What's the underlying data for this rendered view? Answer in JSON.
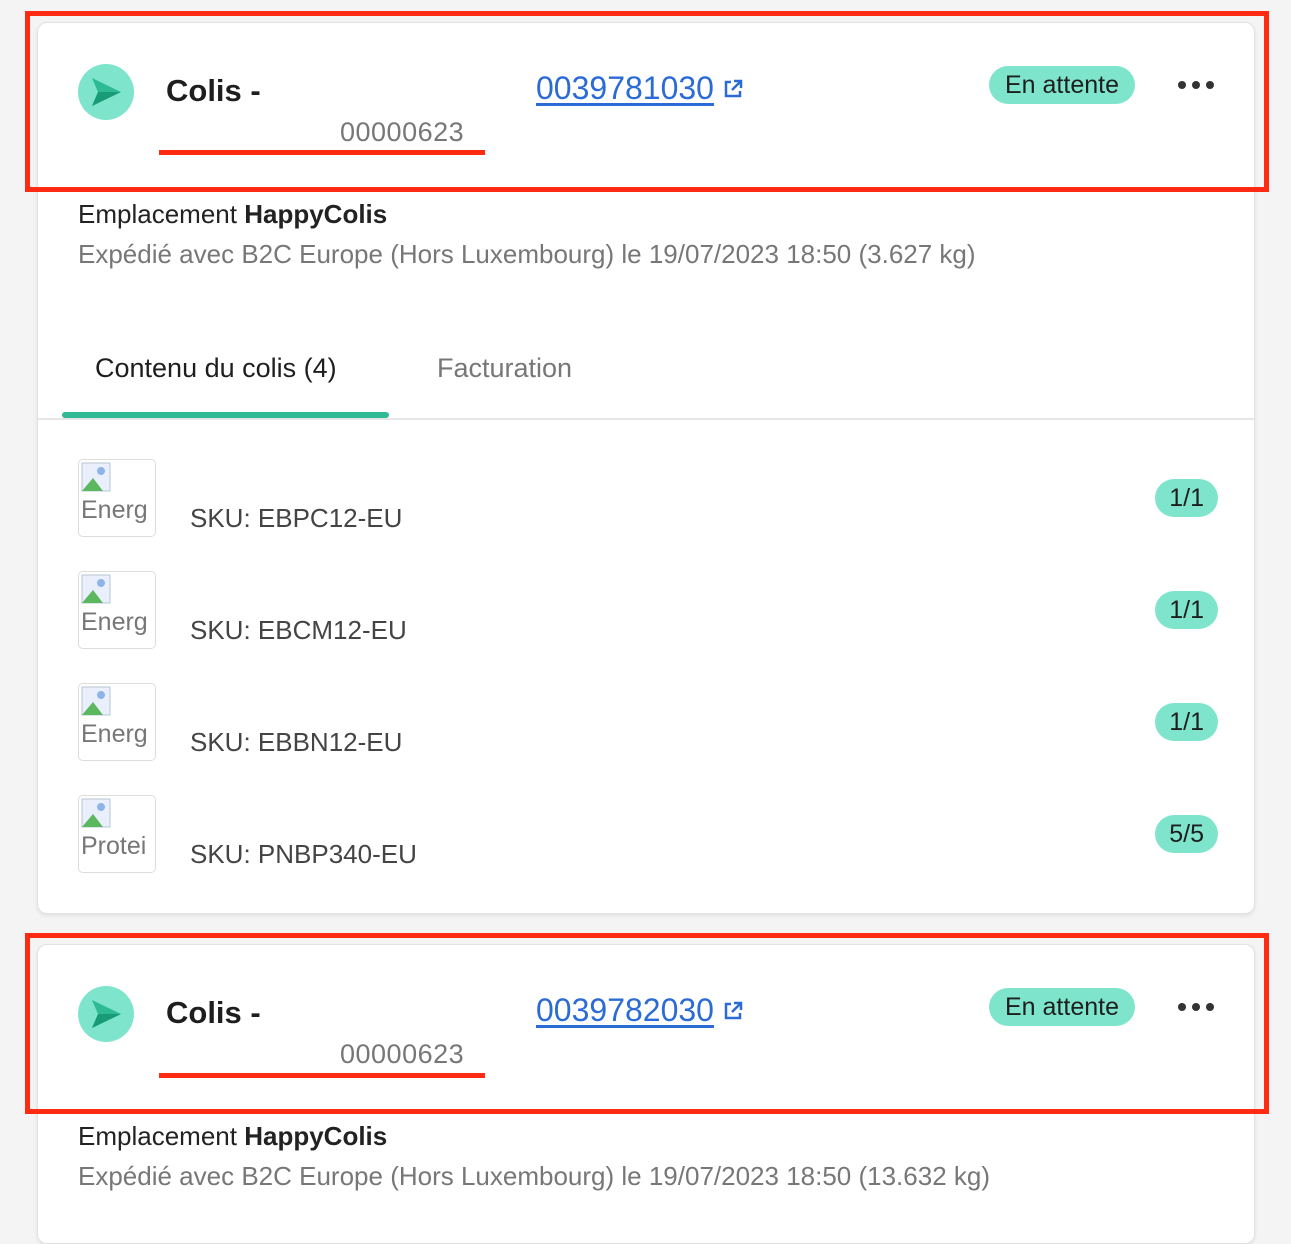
{
  "packages": [
    {
      "title": "Colis -",
      "number": "00000623",
      "tracking": "0039781030",
      "status": "En attente",
      "location_label": "Emplacement",
      "location_name": "HappyColis",
      "shipped": "Expédié avec B2C Europe (Hors Luxembourg) le 19/07/2023 18:50 (3.627 kg)",
      "tabs": [
        "Contenu du colis (4)",
        "Facturation"
      ],
      "items": [
        {
          "alt": "Energ",
          "sku": "SKU: EBPC12-EU",
          "qty": "1/1"
        },
        {
          "alt": "Energ",
          "sku": "SKU: EBCM12-EU",
          "qty": "1/1"
        },
        {
          "alt": "Energ",
          "sku": "SKU: EBBN12-EU",
          "qty": "1/1"
        },
        {
          "alt": "Protei",
          "sku": "SKU: PNBP340-EU",
          "qty": "5/5"
        }
      ]
    },
    {
      "title": "Colis -",
      "number": "00000623",
      "tracking": "0039782030",
      "status": "En attente",
      "location_label": "Emplacement",
      "location_name": "HappyColis",
      "shipped": "Expédié avec B2C Europe (Hors Luxembourg) le 19/07/2023 18:50 (13.632 kg)"
    }
  ],
  "colors": {
    "accent": "#7ee5cc",
    "tab_active": "#2dba94",
    "link": "#2b6bd6",
    "highlight": "#ff2a12"
  },
  "icons": [
    "send-icon",
    "external-link-icon",
    "more-options-icon",
    "broken-image-icon"
  ]
}
